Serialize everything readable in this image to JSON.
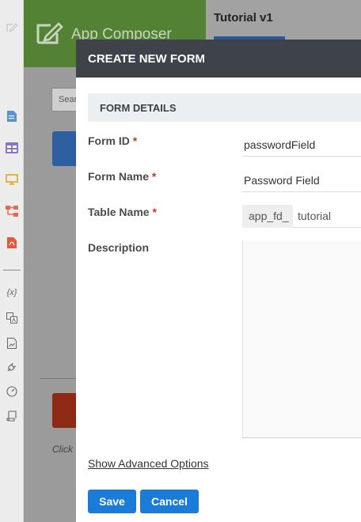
{
  "app": {
    "title": "App Composer",
    "version_title": "Tutorial v1",
    "search_placeholder": "Sear",
    "background_hint": "Click"
  },
  "rail_icons": [
    "edit-icon",
    "document-icon",
    "table-icon",
    "monitor-icon",
    "hierarchy-icon",
    "pdf-icon",
    "variable-icon",
    "translate-icon",
    "image-file-icon",
    "plugin-icon",
    "gauge-icon",
    "scroll-icon"
  ],
  "rail_variable_text": "{x}",
  "modal": {
    "title": "CREATE NEW FORM",
    "section_title": "FORM DETAILS",
    "fields": {
      "form_id": {
        "label": "Form ID",
        "required": "*",
        "value": "passwordField"
      },
      "form_name": {
        "label": "Form Name",
        "required": "*",
        "value": "Password Field"
      },
      "table_name": {
        "label": "Table Name",
        "required": "*",
        "prefix": "app_fd_",
        "value": "tutorial"
      },
      "description": {
        "label": "Description",
        "value": ""
      }
    },
    "advanced_link": "Show Advanced Options",
    "save_label": "Save",
    "cancel_label": "Cancel"
  },
  "colors": {
    "header_green": "#548235",
    "modal_header": "#3d4348",
    "primary_button": "#1a7bd8",
    "required": "#c0392b"
  }
}
